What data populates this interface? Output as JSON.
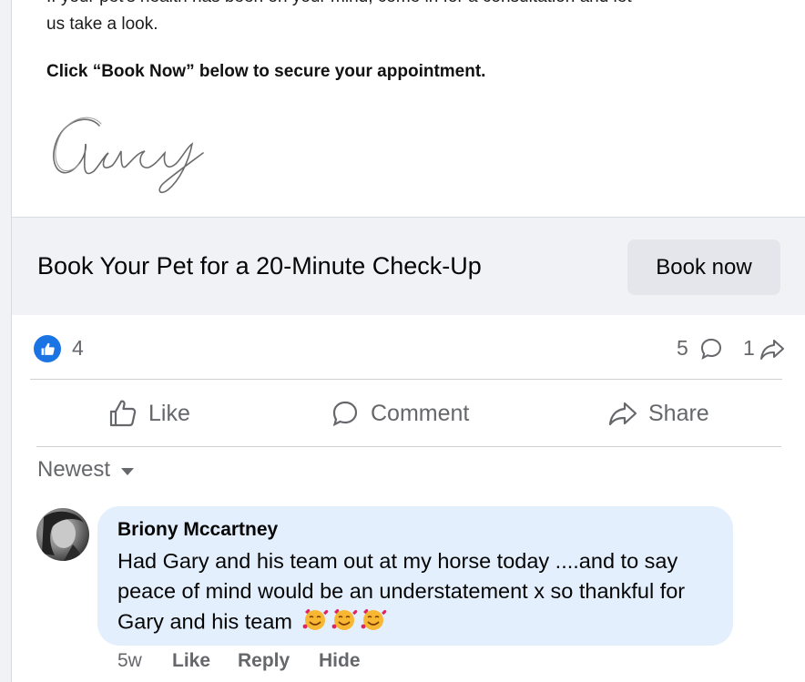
{
  "post": {
    "body_partial_line1": "If your pet's health has been on your mind, come in for a consultation and let",
    "body_partial_line2": "us take a look.",
    "cta_text": "Click “Book Now” below to secure your appointment.",
    "signature_text": "Gary"
  },
  "link_preview": {
    "title": "Book Your Pet for a 20-Minute Check-Up",
    "button_label": "Book now"
  },
  "stats": {
    "like_count": "4",
    "comment_count": "5",
    "share_count": "1"
  },
  "actions": {
    "like_label": "Like",
    "comment_label": "Comment",
    "share_label": "Share"
  },
  "comments": {
    "sort_label": "Newest",
    "items": [
      {
        "author": "Briony Mccartney",
        "text": "Had Gary and his team out at my horse today ....and to say peace of mind would be an understatement x so thankful for Gary and his team",
        "emojis": "smiling-face-with-hearts x3",
        "time": "5w",
        "like_label": "Like",
        "reply_label": "Reply",
        "hide_label": "Hide"
      }
    ]
  },
  "colors": {
    "accent_blue": "#1b74e4",
    "bubble_bg": "#e4effd",
    "link_preview_bg": "#f0f2f5",
    "secondary_text": "#65676b"
  }
}
